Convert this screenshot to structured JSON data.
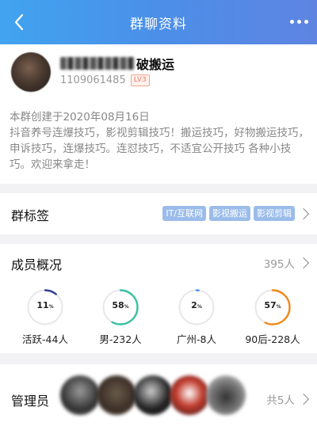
{
  "header": {
    "title": "群聊资料"
  },
  "group": {
    "name_suffix": "破搬运",
    "id": "1109061485",
    "level": "LV3",
    "description": "本群创建于2020年08月16日\n抖音养号连爆技巧，影视剪辑技巧！搬运技巧，好物搬运技巧，申诉技巧，连爆技巧。连怼技巧，不适宜公开技巧 各种小技巧。欢迎来拿走！"
  },
  "tags_section": {
    "label": "群标签",
    "tags": [
      "IT/互联网",
      "影视搬运",
      "影视剪辑"
    ]
  },
  "members_section": {
    "label": "成员概况",
    "count": "395人",
    "stats": [
      {
        "value": 11,
        "value_text": "11",
        "unit": "%",
        "label": "活跃-44人",
        "color": "#2c3e8f"
      },
      {
        "value": 58,
        "value_text": "58",
        "unit": "%",
        "label": "男-232人",
        "color": "#3bbfa3"
      },
      {
        "value": 2,
        "value_text": "2",
        "unit": "%",
        "label": "广州-8人",
        "color": "#4b8fe8"
      },
      {
        "value": 57,
        "value_text": "57",
        "unit": "%",
        "label": "90后-228人",
        "color": "#f08a1c"
      }
    ]
  },
  "admin_section": {
    "label": "管理员",
    "count": "共5人"
  }
}
